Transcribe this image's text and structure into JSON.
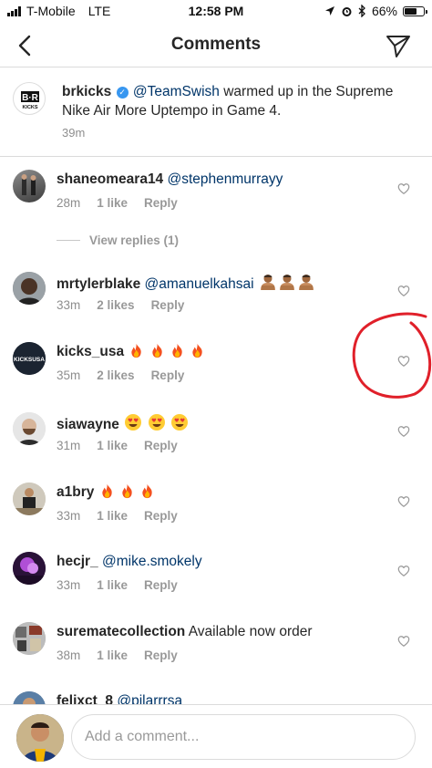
{
  "status_bar": {
    "carrier": "T-Mobile",
    "network": "LTE",
    "time": "12:58 PM",
    "battery": "66%",
    "battery_level": 0.66
  },
  "nav": {
    "title": "Comments"
  },
  "caption": {
    "username": "brkicks",
    "mention": "@TeamSwish",
    "text": " warmed up in the Supreme Nike Air More Uptempo in Game 4.",
    "time": "39m"
  },
  "comments": [
    {
      "username": "shaneomeara14",
      "mention": "@stephenmurrayy",
      "text": "",
      "emoji": "",
      "time": "28m",
      "likes": "1 like",
      "reply": "Reply"
    },
    {
      "username": "mrtylerblake",
      "mention": "@amanuelkahsai",
      "text": "",
      "emoji": "person-tipping-hand ×3",
      "time": "33m",
      "likes": "2 likes",
      "reply": "Reply"
    },
    {
      "username": "kicks_usa",
      "mention": "",
      "text": "",
      "emoji": "fire ×4",
      "time": "35m",
      "likes": "2 likes",
      "reply": "Reply"
    },
    {
      "username": "siawayne",
      "mention": "",
      "text": "",
      "emoji": "heart-eyes ×3",
      "time": "31m",
      "likes": "1 like",
      "reply": "Reply"
    },
    {
      "username": "a1bry",
      "mention": "",
      "text": "",
      "emoji": "fire ×3",
      "time": "33m",
      "likes": "1 like",
      "reply": "Reply"
    },
    {
      "username": "hecjr_",
      "mention": "@mike.smokely",
      "text": "",
      "emoji": "",
      "time": "33m",
      "likes": "1 like",
      "reply": "Reply"
    },
    {
      "username": "suremate​collection",
      "mention": "",
      "text": " Available now order",
      "emoji": "",
      "time": "38m",
      "likes": "1 like",
      "reply": "Reply"
    },
    {
      "username": "felixct_8",
      "mention": "@pilarrrsa",
      "text": "",
      "emoji": "",
      "time": "",
      "likes": "",
      "reply": ""
    }
  ],
  "view_replies": "View replies (1)",
  "input": {
    "placeholder": "Add a comment..."
  },
  "colors": {
    "mention": "#003569",
    "verified": "#3897f0",
    "annotation": "#e0202a"
  },
  "icons": [
    "back-chevron-icon",
    "send-icon",
    "heart-icon",
    "verified-badge-icon",
    "fire-emoji",
    "heart-eyes-emoji",
    "person-emoji"
  ]
}
